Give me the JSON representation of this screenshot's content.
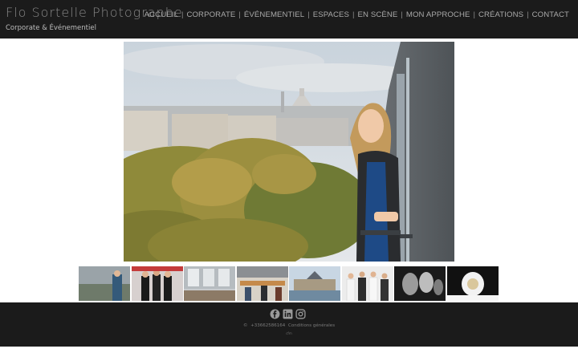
{
  "header": {
    "brand_title": "Flo Sortelle Photographe",
    "brand_subtitle": "Corporate & Événementiel",
    "nav": [
      {
        "label": "ACCUEIL"
      },
      {
        "label": "CORPORATE"
      },
      {
        "label": "ÉVÉNEMENTIEL"
      },
      {
        "label": "ESPACES"
      },
      {
        "label": "EN SCÈNE"
      },
      {
        "label": "MON APPROCHE"
      },
      {
        "label": "CRÉATIONS"
      },
      {
        "label": "CONTACT"
      }
    ],
    "separator": "|"
  },
  "hero": {
    "icon": "hero-photo"
  },
  "thumbnails": [
    {
      "icon": "thumb-lake-portrait"
    },
    {
      "icon": "thumb-event-group"
    },
    {
      "icon": "thumb-office-space"
    },
    {
      "icon": "thumb-cafeteria"
    },
    {
      "icon": "thumb-chateau"
    },
    {
      "icon": "thumb-team-portrait"
    },
    {
      "icon": "thumb-stage-dancers"
    },
    {
      "icon": "thumb-product-speaker"
    }
  ],
  "footer": {
    "social": [
      {
        "icon": "facebook-icon"
      },
      {
        "icon": "linkedin-icon"
      },
      {
        "icon": "instagram-icon"
      }
    ],
    "copyright": "©",
    "phone": "+33662586164",
    "terms": "Conditions générales",
    "small": "cfm"
  },
  "colors": {
    "header_bg": "#1b1b1b",
    "nav_text": "#a9a9a9",
    "brand_text": "#8a8a8a"
  }
}
